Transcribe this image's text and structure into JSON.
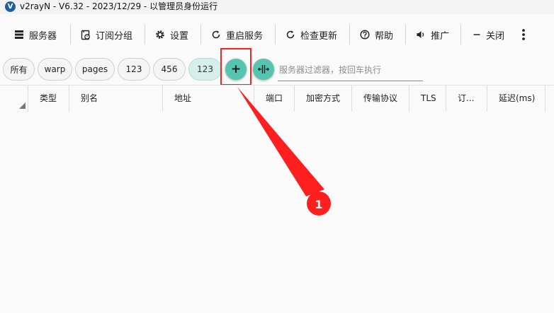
{
  "window": {
    "title": "v2rayN - V6.32 - 2023/12/29 - 以管理员身份运行",
    "logo_letter": "V"
  },
  "toolbar": {
    "servers": "服务器",
    "subscription": "订阅分组",
    "settings": "设置",
    "restart": "重启服务",
    "update": "检查更新",
    "help": "帮助",
    "promote": "推广",
    "close": "关闭"
  },
  "filter": {
    "chips": [
      "所有",
      "warp",
      "pages",
      "123",
      "456",
      "123"
    ],
    "active_index": 5,
    "add_symbol": "+",
    "placeholder": "服务器过滤器，按回车执行"
  },
  "grid": {
    "columns": [
      "类型",
      "别名",
      "地址",
      "端口",
      "加密方式",
      "传输协议",
      "TLS",
      "订...",
      "延迟(ms)"
    ]
  },
  "annotation": {
    "step": "1",
    "color": "#ff1f1f"
  },
  "colors": {
    "accent": "#55c4b0",
    "active_chip": "#d7efea",
    "annotation": "#ff1f1f"
  }
}
